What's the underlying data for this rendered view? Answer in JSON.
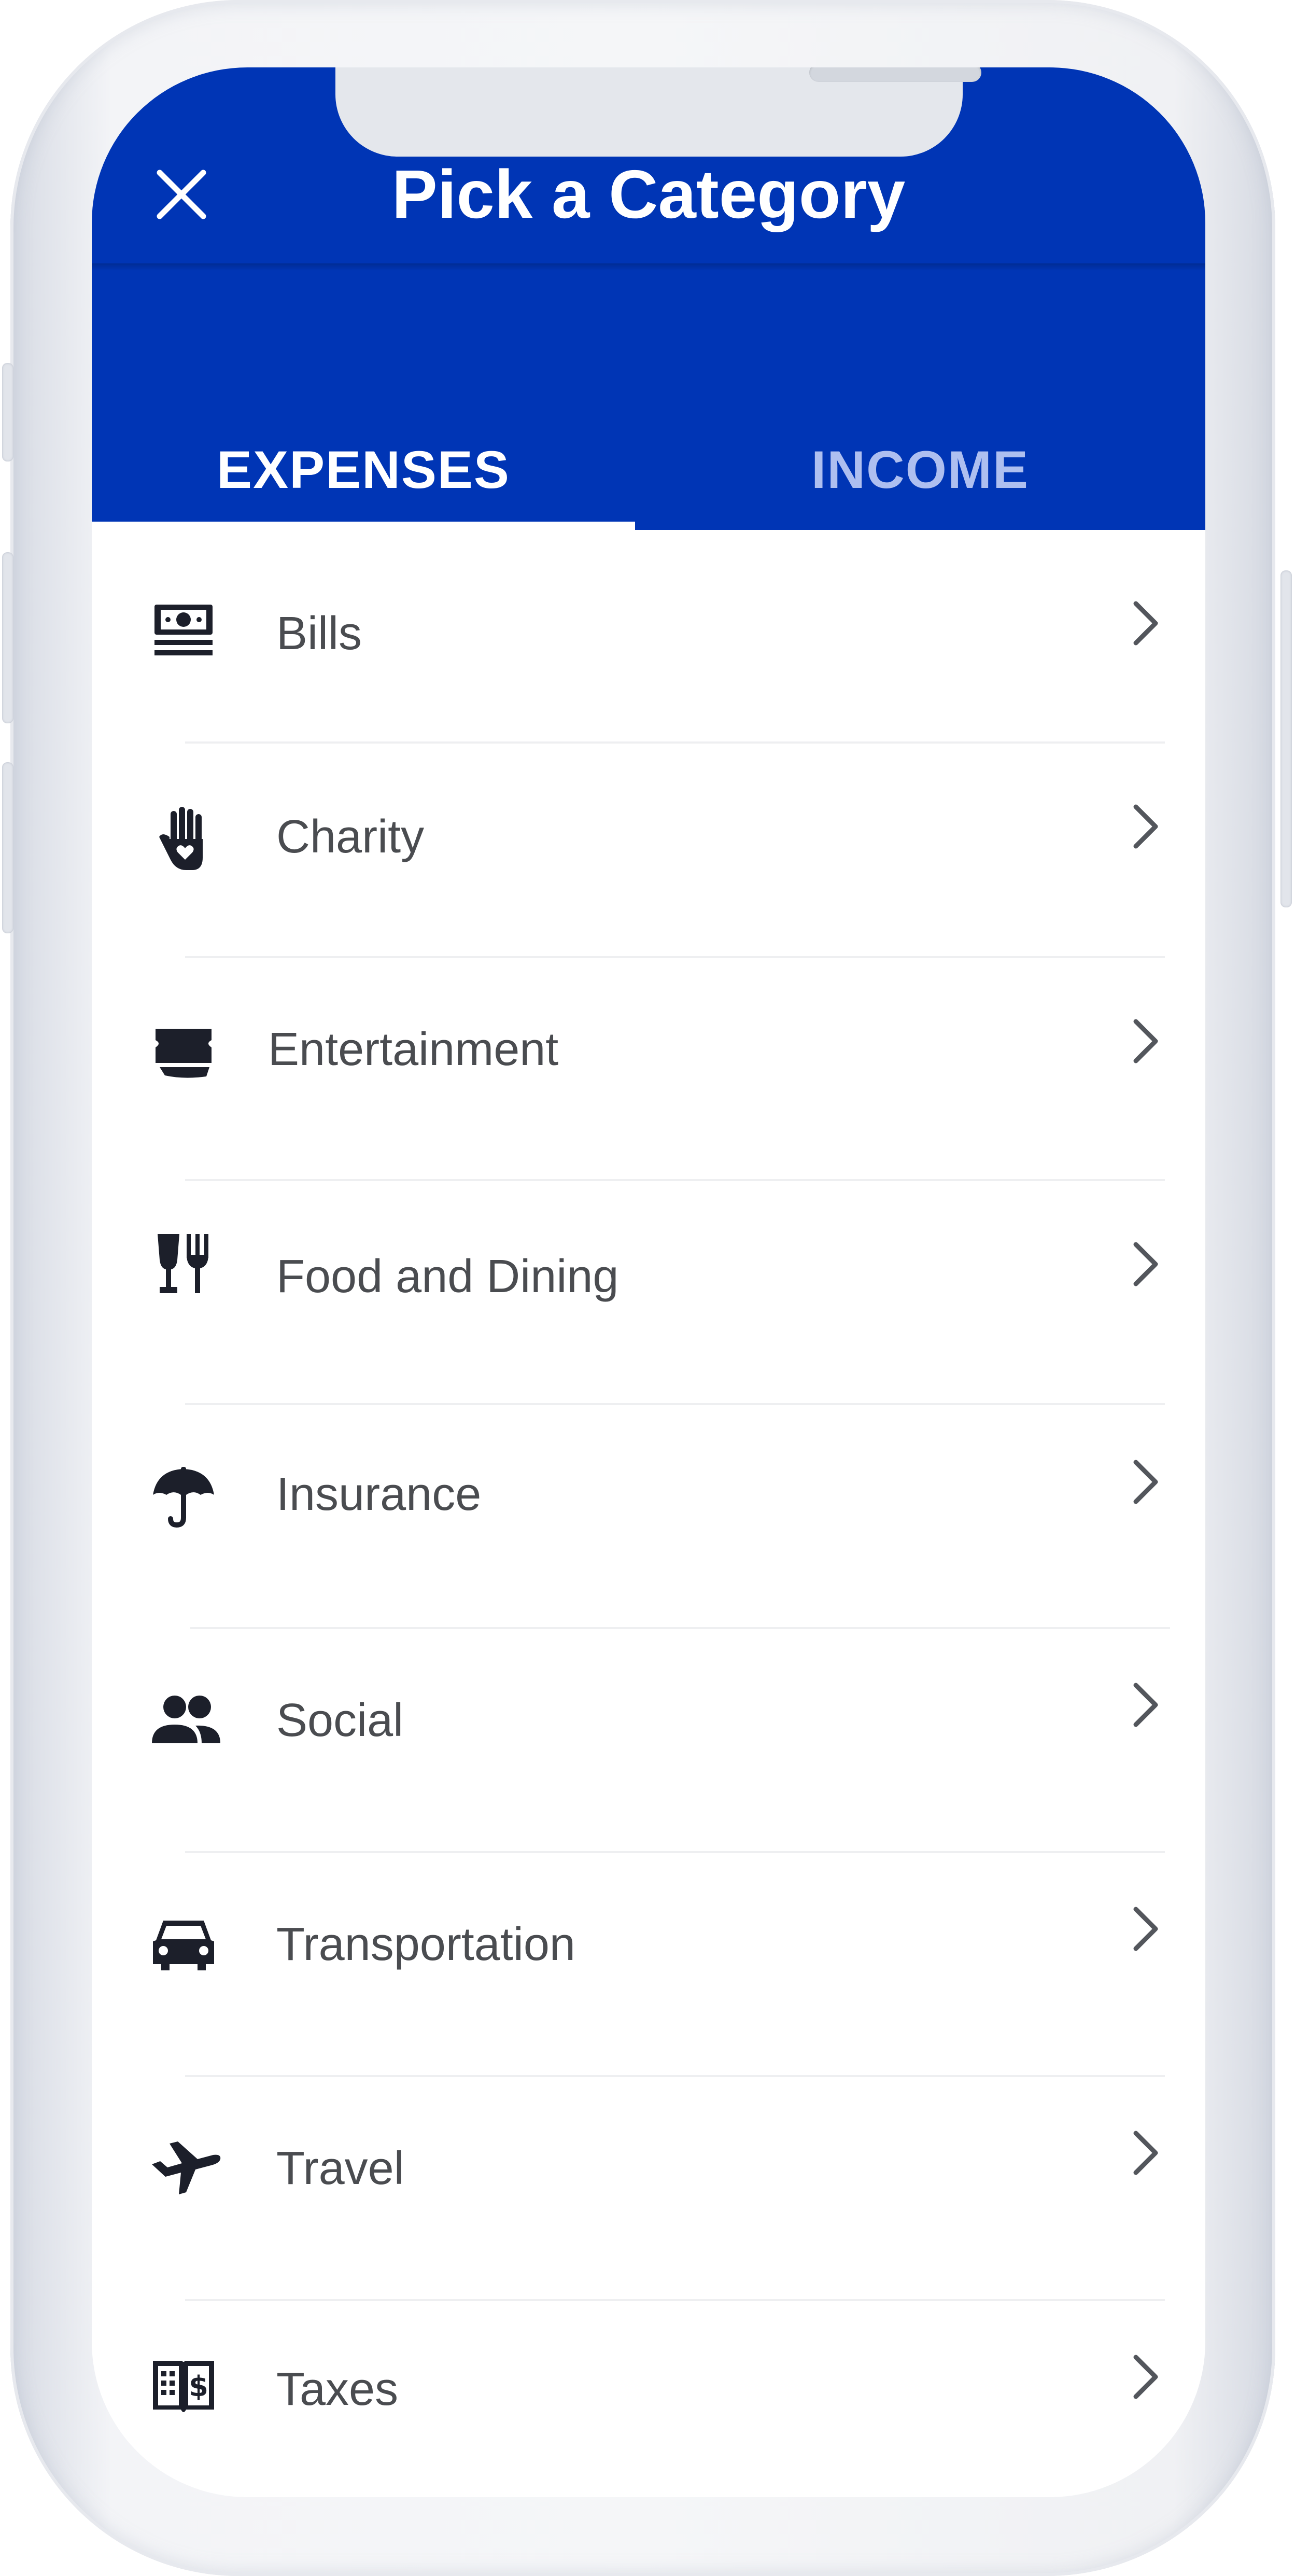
{
  "header": {
    "title": "Pick a Category",
    "close_icon": "close-icon",
    "background_color": "#0035b5"
  },
  "tabs": [
    {
      "label": "EXPENSES",
      "active": true
    },
    {
      "label": "INCOME",
      "active": false
    }
  ],
  "categories": [
    {
      "label": "Bills",
      "icon": "money-bill-icon"
    },
    {
      "label": "Charity",
      "icon": "hand-heart-icon"
    },
    {
      "label": "Entertainment",
      "icon": "ticket-icon"
    },
    {
      "label": "Food and Dining",
      "icon": "glass-fork-icon"
    },
    {
      "label": "Insurance",
      "icon": "umbrella-icon"
    },
    {
      "label": "Social",
      "icon": "people-icon"
    },
    {
      "label": "Transportation",
      "icon": "car-icon"
    },
    {
      "label": "Travel",
      "icon": "airplane-icon"
    },
    {
      "label": "Taxes",
      "icon": "tax-book-icon"
    }
  ],
  "colors": {
    "accent": "#0035b5",
    "inactive_tab": "#aebff0",
    "label_text": "#4a4c50",
    "icon": "#1c1f2a"
  }
}
